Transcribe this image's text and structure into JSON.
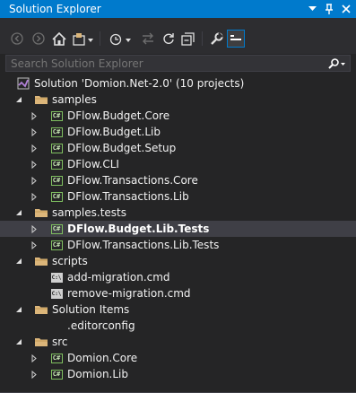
{
  "window": {
    "title": "Solution Explorer",
    "accent_color": "#007acc",
    "background": "#252526"
  },
  "title_buttons": [
    {
      "name": "dropdown-icon"
    },
    {
      "name": "pin-icon"
    },
    {
      "name": "close-icon"
    }
  ],
  "toolbar": {
    "buttons": [
      "back-icon",
      "forward-icon",
      "home-icon",
      "switch-views-icon",
      "pending-changes-filter-icon",
      "sync-with-active-document-icon",
      "refresh-icon",
      "collapse-all-icon",
      "show-all-files-icon",
      "properties-icon",
      "preview-selected-items-icon"
    ]
  },
  "search": {
    "placeholder": "Search Solution Explorer"
  },
  "tree": [
    {
      "type": "solution",
      "label": "Solution 'Domion.Net-2.0' (10 projects)",
      "level": 0,
      "arrow": "none"
    },
    {
      "type": "folder",
      "label": "samples",
      "level": 1,
      "arrow": "expanded"
    },
    {
      "type": "csproj",
      "label": "DFlow.Budget.Core",
      "level": 2,
      "arrow": "collapsed"
    },
    {
      "type": "csproj",
      "label": "DFlow.Budget.Lib",
      "level": 2,
      "arrow": "collapsed"
    },
    {
      "type": "csproj",
      "label": "DFlow.Budget.Setup",
      "level": 2,
      "arrow": "collapsed"
    },
    {
      "type": "csproj",
      "label": "DFlow.CLI",
      "level": 2,
      "arrow": "collapsed"
    },
    {
      "type": "csproj",
      "label": "DFlow.Transactions.Core",
      "level": 2,
      "arrow": "collapsed"
    },
    {
      "type": "csproj",
      "label": "DFlow.Transactions.Lib",
      "level": 2,
      "arrow": "collapsed"
    },
    {
      "type": "folder",
      "label": "samples.tests",
      "level": 1,
      "arrow": "expanded"
    },
    {
      "type": "csproj",
      "label": "DFlow.Budget.Lib.Tests",
      "level": 2,
      "arrow": "collapsed",
      "selected": true
    },
    {
      "type": "csproj",
      "label": "DFlow.Transactions.Lib.Tests",
      "level": 2,
      "arrow": "collapsed"
    },
    {
      "type": "folder",
      "label": "scripts",
      "level": 1,
      "arrow": "expanded"
    },
    {
      "type": "cmd",
      "label": "add-migration.cmd",
      "level": 2,
      "arrow": "none"
    },
    {
      "type": "cmd",
      "label": "remove-migration.cmd",
      "level": 2,
      "arrow": "none"
    },
    {
      "type": "folder",
      "label": "Solution Items",
      "level": 1,
      "arrow": "expanded"
    },
    {
      "type": "file",
      "label": ".editorconfig",
      "level": 2,
      "arrow": "none"
    },
    {
      "type": "folder",
      "label": "src",
      "level": 1,
      "arrow": "expanded"
    },
    {
      "type": "csproj",
      "label": "Domion.Core",
      "level": 2,
      "arrow": "collapsed"
    },
    {
      "type": "csproj",
      "label": "Domion.Lib",
      "level": 2,
      "arrow": "collapsed"
    }
  ]
}
